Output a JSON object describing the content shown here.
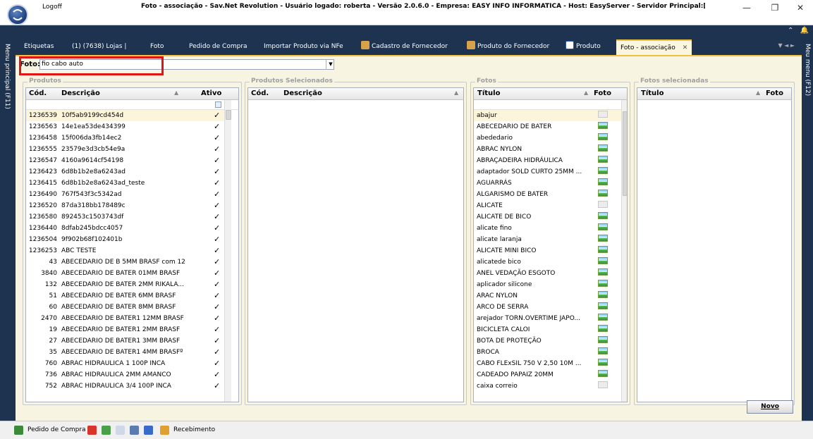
{
  "titlebar": {
    "logoff": "Logoff",
    "title": "Foto - associação - Sav.Net Revolution - Usuário logado: roberta - Versão 2.0.6.0 - Empresa: EASY INFO INFORMÁTICA - Host: EasyServer - Servidor Principal:[SIM]",
    "minimize": "—",
    "maximize": "❐",
    "close": "✕"
  },
  "ribbon": {
    "collapse": "⌃",
    "bell": "🔔"
  },
  "rails": {
    "left": "Menu principal (F11)",
    "right": "Meu menu (F12)"
  },
  "tabs": [
    {
      "label": "Etiquetas",
      "icon": "",
      "active": false
    },
    {
      "label": "(1) (7638) Lojas |",
      "icon": "",
      "active": false
    },
    {
      "label": "Foto",
      "icon": "",
      "active": false
    },
    {
      "label": "Pedido de Compra",
      "icon": "",
      "active": false
    },
    {
      "label": "Importar Produto via NFe",
      "icon": "",
      "active": false
    },
    {
      "label": "Cadastro de Fornecedor",
      "icon": "supplier-icon",
      "active": false
    },
    {
      "label": "Produto do Fornecedor",
      "icon": "supplier-product-icon",
      "active": false
    },
    {
      "label": "Produto",
      "icon": "product-icon",
      "active": false
    },
    {
      "label": "Foto - associação",
      "icon": "",
      "active": true,
      "close": "✕"
    }
  ],
  "tab_scroll": "▼ ◄ ►",
  "filter": {
    "label": "Foto:",
    "value": "fio cabo auto",
    "dropdown": "▼"
  },
  "produtos": {
    "title": "Produtos",
    "headers": {
      "cod": "Cód.",
      "descricao": "Descrição",
      "ativo": "Ativo"
    },
    "rows": [
      [
        "1236539",
        "10f5ab9199cd454d"
      ],
      [
        "1236563",
        "14e1ea53de434399"
      ],
      [
        "1236458",
        "15f006da3fb14ec2"
      ],
      [
        "1236555",
        "23579e3d3cb54e9a"
      ],
      [
        "1236547",
        "4160a9614cf54198"
      ],
      [
        "1236423",
        "6d8b1b2e8a6243ad"
      ],
      [
        "1236415",
        "6d8b1b2e8a6243ad_teste"
      ],
      [
        "1236490",
        "767f543f3c5342ad"
      ],
      [
        "1236520",
        "87da318bb178489c"
      ],
      [
        "1236580",
        "892453c1503743df"
      ],
      [
        "1236440",
        "8dfab245bdcc4057"
      ],
      [
        "1236504",
        "9f902b68f102401b"
      ],
      [
        "1236253",
        "ABC TESTE"
      ],
      [
        "43",
        "ABECEDARIO DE B 5MM BRASF com 12"
      ],
      [
        "3840",
        "ABECEDARIO DE BATER 01MM BRASF"
      ],
      [
        "132",
        "ABECEDARIO DE BATER 2MM RIKALA..."
      ],
      [
        "51",
        "ABECEDARIO DE BATER 6MM BRASF"
      ],
      [
        "60",
        "ABECEDARIO DE BATER 8MM BRASF"
      ],
      [
        "2470",
        "ABECEDARIO DE BATER1 12MM BRASF"
      ],
      [
        "19",
        "ABECEDARIO DE BATER1 2MM BRASF"
      ],
      [
        "27",
        "ABECEDARIO DE BATER1 3MM BRASF"
      ],
      [
        "35",
        "ABECEDARIO DE BATER1 4MM BRASFº"
      ],
      [
        "760",
        "ABRAC HIDRAULICA 1 100P INCA"
      ],
      [
        "736",
        "ABRAC HIDRAULICA 2MM AMANCO"
      ],
      [
        "752",
        "ABRAC HIDRAULICA 3/4 100P INCA"
      ]
    ],
    "check": "✓"
  },
  "selecionados": {
    "title": "Produtos Selecionados",
    "headers": {
      "cod": "Cód.",
      "descricao": "Descrição"
    }
  },
  "fotos": {
    "title": "Fotos",
    "headers": {
      "titulo": "Título",
      "foto": "Foto"
    },
    "rows": [
      [
        "abajur",
        "empty"
      ],
      [
        "ABECEDARIO DE BATER",
        "full"
      ],
      [
        "abededario",
        "full"
      ],
      [
        "ABRAC NYLON",
        "full"
      ],
      [
        "ABRAÇADEIRA HIDRÁULICA",
        "full"
      ],
      [
        "adaptador SOLD CURTO 25MM ...",
        "full"
      ],
      [
        "AGUARRÁS",
        "full"
      ],
      [
        "ALGARISMO DE BATER",
        "full"
      ],
      [
        "ALICATE",
        "empty"
      ],
      [
        "ALICATE DE BICO",
        "full"
      ],
      [
        "alicate fino",
        "full"
      ],
      [
        "alicate laranja",
        "full"
      ],
      [
        "ALICATE MINI BICO",
        "full"
      ],
      [
        "alicatede bico",
        "full"
      ],
      [
        "ANEL VEDAÇÃO ESGOTO",
        "full"
      ],
      [
        "aplicador silicone",
        "full"
      ],
      [
        "ARAC NYLON",
        "full"
      ],
      [
        "ARCO DE SERRA",
        "full"
      ],
      [
        "arejador TORN.OVERTIME JAPO...",
        "full"
      ],
      [
        "BICICLETA CALOI",
        "full"
      ],
      [
        "BOTA DE PROTEÇÃO",
        "full"
      ],
      [
        "BROCA",
        "full"
      ],
      [
        "CABO FLExSIL 750 V 2,50 10M ...",
        "full"
      ],
      [
        "CADEADO PAPAIZ 20MM",
        "full"
      ],
      [
        "caixa correio",
        "empty"
      ]
    ]
  },
  "fotos_selecionadas": {
    "title": "Fotos selecionadas",
    "headers": {
      "titulo": "Título",
      "foto": "Foto"
    }
  },
  "novo_button": "Novo",
  "statusbar": {
    "pedido": "Pedido de Compra",
    "recebimento": "Recebimento"
  },
  "colors": {
    "accent": "#f0c040",
    "navy": "#1e3350",
    "panel": "#f7f4e2",
    "highlight": "#e01515"
  }
}
